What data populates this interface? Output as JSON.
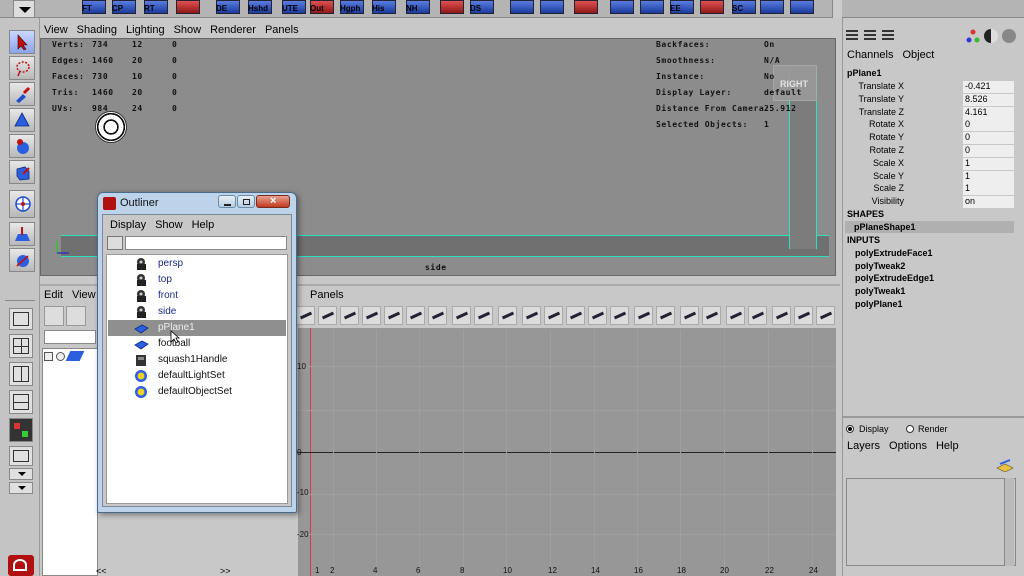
{
  "shelf": {
    "labels": [
      "FT",
      "CP",
      "RT",
      "DE",
      "Hshd",
      "UTE",
      "Out",
      "Hgph",
      "His",
      "NH",
      "DS",
      "EE",
      "SC"
    ]
  },
  "viewport": {
    "menu": [
      "View",
      "Shading",
      "Lighting",
      "Show",
      "Renderer",
      "Panels"
    ],
    "hud_left": [
      {
        "label": "Verts:",
        "v1": "734",
        "v2": "12",
        "v3": "0"
      },
      {
        "label": "Edges:",
        "v1": "1460",
        "v2": "20",
        "v3": "0"
      },
      {
        "label": "Faces:",
        "v1": "730",
        "v2": "10",
        "v3": "0"
      },
      {
        "label": "Tris:",
        "v1": "1460",
        "v2": "20",
        "v3": "0"
      },
      {
        "label": "UVs:",
        "v1": "984",
        "v2": "24",
        "v3": "0"
      }
    ],
    "hud_right": [
      {
        "label": "Backfaces:",
        "value": "On"
      },
      {
        "label": "Smoothness:",
        "value": "N/A"
      },
      {
        "label": "Instance:",
        "value": "No"
      },
      {
        "label": "Display Layer:",
        "value": "default"
      },
      {
        "label": "Distance From Camera:",
        "value": "25.912"
      },
      {
        "label": "Selected Objects:",
        "value": "1"
      }
    ],
    "view_cube_label": "RIGHT",
    "camera_label": "side"
  },
  "graph_editor": {
    "menu_left": [
      "Edit",
      "View"
    ],
    "menu_right": "Panels",
    "y_ticks": [
      "10",
      "0",
      "-10",
      "-20"
    ],
    "x_ticks": [
      "1",
      "2",
      "4",
      "6",
      "8",
      "10",
      "12",
      "14",
      "16",
      "18",
      "20",
      "22",
      "24"
    ]
  },
  "outliner": {
    "title": "Outliner",
    "menu": [
      "Display",
      "Show",
      "Help"
    ],
    "items": [
      {
        "label": "persp",
        "icon": "camera-icon"
      },
      {
        "label": "top",
        "icon": "camera-icon"
      },
      {
        "label": "front",
        "icon": "camera-icon"
      },
      {
        "label": "side",
        "icon": "camera-icon"
      },
      {
        "label": "pPlane1",
        "icon": "mesh-icon"
      },
      {
        "label": "football",
        "icon": "mesh-icon"
      },
      {
        "label": "squash1Handle",
        "icon": "deformer-handle-icon"
      },
      {
        "label": "defaultLightSet",
        "icon": "set-icon"
      },
      {
        "label": "defaultObjectSet",
        "icon": "set-icon"
      }
    ],
    "selected_index": 4
  },
  "channel_box": {
    "menu": [
      "Channels",
      "Object"
    ],
    "object_name": "pPlane1",
    "channels": [
      {
        "label": "Translate X",
        "value": "-0.421"
      },
      {
        "label": "Translate Y",
        "value": "8.526"
      },
      {
        "label": "Translate Z",
        "value": "4.161"
      },
      {
        "label": "Rotate X",
        "value": "0"
      },
      {
        "label": "Rotate Y",
        "value": "0"
      },
      {
        "label": "Rotate Z",
        "value": "0"
      },
      {
        "label": "Scale X",
        "value": "1"
      },
      {
        "label": "Scale Y",
        "value": "1"
      },
      {
        "label": "Scale Z",
        "value": "1"
      },
      {
        "label": "Visibility",
        "value": "on"
      }
    ],
    "shapes_header": "SHAPES",
    "shape_name": "pPlaneShape1",
    "inputs_header": "INPUTS",
    "inputs": [
      "polyExtrudeFace1",
      "polyTweak2",
      "polyExtrudeEdge1",
      "polyTweak1",
      "polyPlane1"
    ]
  },
  "layer_editor": {
    "radio_display": "Display",
    "radio_render": "Render",
    "menu": [
      "Layers",
      "Options",
      "Help"
    ]
  },
  "bottom": {
    "left_arrows": "<<",
    "right_arrows": ">>"
  }
}
